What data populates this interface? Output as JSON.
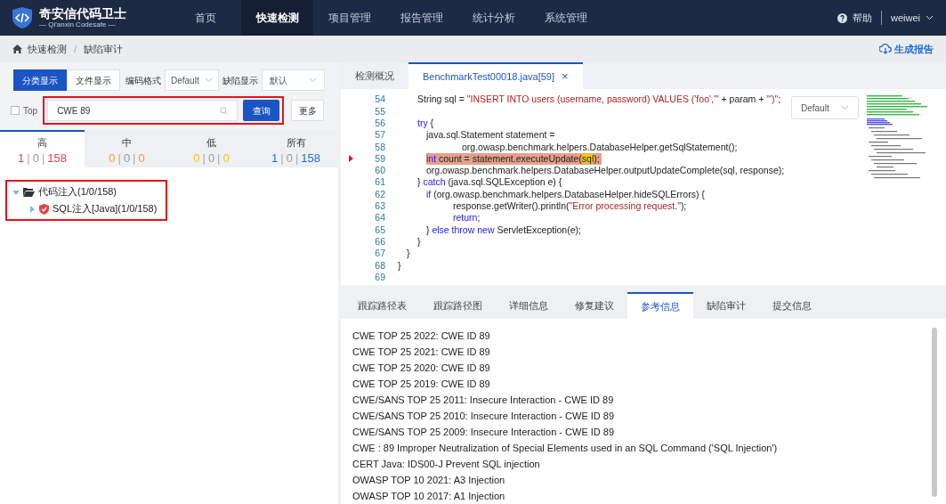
{
  "header": {
    "logo_title": "奇安信代码卫士",
    "logo_subtitle": "— Qi'anxin Codesafe —",
    "nav": [
      {
        "label": "首页",
        "selected": false
      },
      {
        "label": "快速检测",
        "selected": true
      },
      {
        "label": "项目管理",
        "selected": false
      },
      {
        "label": "报告管理",
        "selected": false
      },
      {
        "label": "统计分析",
        "selected": false
      },
      {
        "label": "系统管理",
        "selected": false
      }
    ],
    "help": "帮助",
    "user": "weiwei"
  },
  "breadcrumb": {
    "items": [
      "快速检测",
      "缺陷审计"
    ],
    "separator": "/",
    "action": "生成报告"
  },
  "left": {
    "view_toggle": [
      {
        "label": "分类显示",
        "selected": true
      },
      {
        "label": "文件显示",
        "selected": false
      }
    ],
    "encoding_label": "编码格式",
    "encoding_value": "Default",
    "defect_label": "缺陷显示",
    "defect_value": "默认",
    "top_checkbox": {
      "label": "Top",
      "checked": false
    },
    "search": {
      "value": "CWE 89"
    },
    "query_button": "查询",
    "more_button": "更多",
    "severity_tabs": [
      {
        "label": "高",
        "selected": true,
        "counts": [
          {
            "text": "1",
            "color": "#e8414b"
          },
          {
            "text": "0",
            "color": "#999999"
          },
          {
            "text": "158",
            "color": "#e8414b"
          }
        ]
      },
      {
        "label": "中",
        "selected": false,
        "counts": [
          {
            "text": "0",
            "color": "#f0a020"
          },
          {
            "text": "0",
            "color": "#999999"
          },
          {
            "text": "0",
            "color": "#f0a020"
          }
        ]
      },
      {
        "label": "低",
        "selected": false,
        "counts": [
          {
            "text": "0",
            "color": "#f5c518"
          },
          {
            "text": "0",
            "color": "#999999"
          },
          {
            "text": "0",
            "color": "#f5c518"
          }
        ]
      },
      {
        "label": "所有",
        "selected": false,
        "counts": [
          {
            "text": "1",
            "color": "#1f6fd0"
          },
          {
            "text": "0",
            "color": "#999999"
          },
          {
            "text": "158",
            "color": "#1f6fd0"
          }
        ]
      }
    ],
    "count_separator": "|",
    "tree": [
      {
        "label": "代码注入(1/0/158)",
        "expanded": true,
        "children": [
          {
            "label": "SQL注入[Java](1/0/158)",
            "expanded": false
          }
        ]
      }
    ]
  },
  "editor": {
    "tabs": [
      {
        "label": "检测概况",
        "selected": false,
        "closable": false
      },
      {
        "label": "BenchmarkTest00018.java[59]",
        "selected": true,
        "closable": true
      }
    ],
    "close_glyph": "×",
    "encoding_select": "Default",
    "lines": [
      {
        "children": [
          {
            "children": [
              {
                "number": "54",
                "highlighted": false,
                "tokens": [
                  {
                    "kind": "plain",
                    "text": "String sql = "
                  },
                  {
                    "kind": "string",
                    "text": "\"INSERT INTO users (username, password) VALUES ('foo','\""
                  },
                  {
                    "kind": "plain",
                    "text": " + param + "
                  },
                  {
                    "kind": "string",
                    "text": "\"')\""
                  },
                  {
                    "kind": "plain",
                    "text": ";"
                  }
                ]
              },
              {
                "number": "55"
              },
              {
                "number": "56",
                "highlighted": false,
                "tokens": [
                  {
                    "kind": "keyword",
                    "text": "try"
                  },
                  {
                    "kind": "plain",
                    "text": " {"
                  }
                ],
                "children": [
                  {
                    "number": "57",
                    "highlighted": false,
                    "tokens": [
                      {
                        "kind": "plain",
                        "text": "java.sql.Statement statement ="
                      }
                    ],
                    "children": [
                      {
                        "children": [
                          {
                            "number": "58",
                            "highlighted": false,
                            "tokens": [
                              {
                                "kind": "plain",
                                "text": "org.owasp.benchmark.helpers.DatabaseHelper.getSqlStatement();"
                              }
                            ]
                          }
                        ]
                      }
                    ]
                  },
                  {
                    "number": "59",
                    "highlighted": true,
                    "tokens": [
                      {
                        "kind": "keyword",
                        "text": "int"
                      },
                      {
                        "kind": "plain",
                        "text": " count = statement.executeUpdate("
                      },
                      {
                        "kind": "match",
                        "text": "sql"
                      },
                      {
                        "kind": "plain",
                        "text": ");"
                      }
                    ]
                  },
                  {
                    "number": "60",
                    "highlighted": false,
                    "tokens": [
                      {
                        "kind": "plain",
                        "text": "org.owasp.benchmark.helpers.DatabaseHelper.outputUpdateComplete(sql, response);"
                      }
                    ]
                  }
                ]
              },
              {
                "number": "61",
                "highlighted": false,
                "tokens": [
                  {
                    "kind": "plain",
                    "text": "} "
                  },
                  {
                    "kind": "keyword",
                    "text": "catch"
                  },
                  {
                    "kind": "plain",
                    "text": " (java.sql.SQLException e) {"
                  }
                ],
                "children": [
                  {
                    "number": "62",
                    "highlighted": false,
                    "tokens": [
                      {
                        "kind": "keyword",
                        "text": "if"
                      },
                      {
                        "kind": "plain",
                        "text": " (org.owasp.benchmark.helpers.DatabaseHelper.hideSQLErrors) {"
                      }
                    ],
                    "children": [
                      {
                        "number": "63",
                        "highlighted": false,
                        "tokens": [
                          {
                            "kind": "plain",
                            "text": "response.getWriter().println("
                          },
                          {
                            "kind": "string",
                            "text": "\"Error processing request.\""
                          },
                          {
                            "kind": "plain",
                            "text": ");"
                          }
                        ]
                      },
                      {
                        "number": "64",
                        "highlighted": false,
                        "tokens": [
                          {
                            "kind": "keyword",
                            "text": "return"
                          },
                          {
                            "kind": "plain",
                            "text": ";"
                          }
                        ]
                      }
                    ]
                  },
                  {
                    "number": "65",
                    "highlighted": false,
                    "tokens": [
                      {
                        "kind": "plain",
                        "text": "} "
                      },
                      {
                        "kind": "keyword",
                        "text": "else throw new"
                      },
                      {
                        "kind": "plain",
                        "text": " ServletException(e);"
                      }
                    ]
                  }
                ]
              },
              {
                "number": "66",
                "highlighted": false,
                "tokens": [
                  {
                    "kind": "plain",
                    "text": "}"
                  }
                ]
              }
            ]
          },
          {
            "number": "67",
            "highlighted": false,
            "tokens": [
              {
                "kind": "plain",
                "text": "}"
              }
            ]
          }
        ]
      },
      {
        "number": "68",
        "highlighted": false,
        "tokens": [
          {
            "kind": "plain",
            "text": "}"
          }
        ]
      },
      {
        "number": "69"
      }
    ]
  },
  "detail": {
    "tabs": [
      {
        "label": "跟踪路径表",
        "selected": false
      },
      {
        "label": "跟踪路径图",
        "selected": false
      },
      {
        "label": "详细信息",
        "selected": false
      },
      {
        "label": "修复建议",
        "selected": false
      },
      {
        "label": "参考信息",
        "selected": true
      },
      {
        "label": "缺陷审计",
        "selected": false
      },
      {
        "label": "提交信息",
        "selected": false
      }
    ],
    "references": [
      "CWE TOP 25 2022: CWE ID 89",
      "CWE TOP 25 2021: CWE ID 89",
      "CWE TOP 25 2020: CWE ID 89",
      "CWE TOP 25 2019: CWE ID 89",
      "CWE/SANS TOP 25 2011: Insecure Interaction - CWE ID 89",
      "CWE/SANS TOP 25 2010: Insecure Interaction - CWE ID 89",
      "CWE/SANS TOP 25 2009: Insecure Interaction - CWE ID 89",
      "CWE : 89 Improper Neutralization of Special Elements used in an SQL Command ('SQL Injection')",
      "CERT Java: IDS00-J Prevent SQL injection",
      "OWASP TOP 10 2021: A3 Injection",
      "OWASP TOP 10 2017: A1 Injection"
    ]
  }
}
